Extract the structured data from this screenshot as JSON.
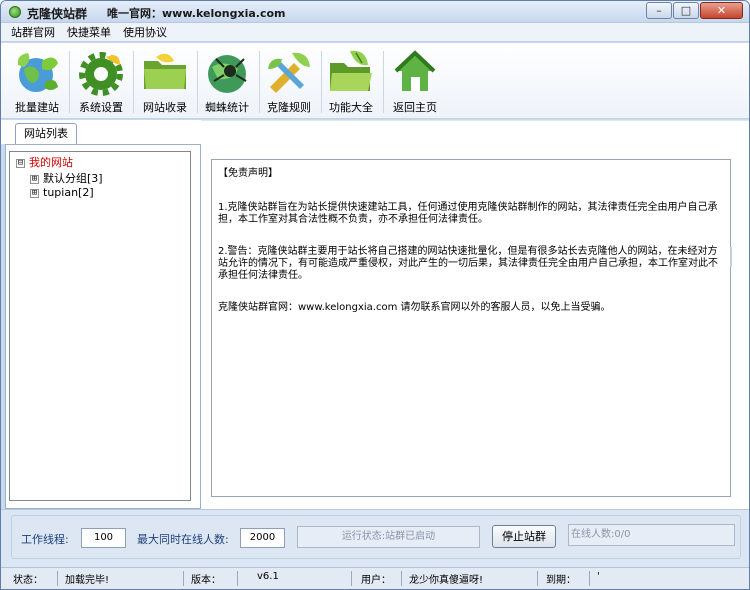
{
  "window": {
    "title": "克隆侠站群",
    "subtitle": "唯一官网：www.kelongxia.com",
    "minimize_glyph": "–",
    "maximize_glyph": "□",
    "close_glyph": "✕"
  },
  "menu": [
    "站群官网",
    "快捷菜单",
    "使用协议"
  ],
  "toolbar": [
    {
      "label": "批量建站",
      "icon": "globe-leaf-icon"
    },
    {
      "label": "系统设置",
      "icon": "gear-icon"
    },
    {
      "label": "网站收录",
      "icon": "folder-icon"
    },
    {
      "label": "蜘蛛统计",
      "icon": "spider-globe-icon"
    },
    {
      "label": "克隆规则",
      "icon": "tools-icon"
    },
    {
      "label": "功能大全",
      "icon": "folder-leaf-icon"
    },
    {
      "label": "返回主页",
      "icon": "home-icon"
    }
  ],
  "left_panel": {
    "tab": "网站列表",
    "tree": {
      "root": {
        "expander": "⊟",
        "label": "我的网站"
      },
      "children": [
        {
          "expander": "⊞",
          "label": "默认分组[3]"
        },
        {
          "expander": "⊞",
          "label": "tupian[2]"
        }
      ]
    }
  },
  "notice": {
    "title": "【免责声明】",
    "p1": "1.克隆侠站群旨在为站长提供快速建站工具，任何通过使用克隆侠站群制作的网站，其法律责任完全由用户自己承担，本工作室对其合法性概不负责，亦不承担任何法律责任。",
    "p2": "2.警告：克隆侠站群主要用于站长将自己搭建的网站快速批量化，但是有很多站长去克隆他人的网站，在未经对方站允许的情况下，有可能造成严重侵权，对此产生的一切后果，其法律责任完全由用户自己承担，本工作室对此不承担任何法律责任。",
    "p3": "克隆侠站群官网：www.kelongxia.com 请勿联系官网以外的客服人员，以免上当受骗。"
  },
  "settings": {
    "threads_label": "工作线程:",
    "threads_value": "100",
    "max_online_label": "最大同时在线人数:",
    "max_online_value": "2000",
    "run_status": "运行状态:站群已启动",
    "stop_button": "停止站群",
    "online_count": "在线人数:0/0"
  },
  "statusbar": {
    "status_label": "状态：",
    "status_value": "加载完毕!",
    "version_label": "版本：",
    "version_value": "v6.1",
    "user_label": "用户：",
    "user_value": "龙少你真傻逼呀!",
    "expire_label": "到期：",
    "expire_value": "'"
  },
  "colors": {
    "accent_blue": "#1f3f7a",
    "tree_root_red": "#cc0000",
    "title_gradient_top": "#e6eef9",
    "close_red": "#c6452c"
  }
}
